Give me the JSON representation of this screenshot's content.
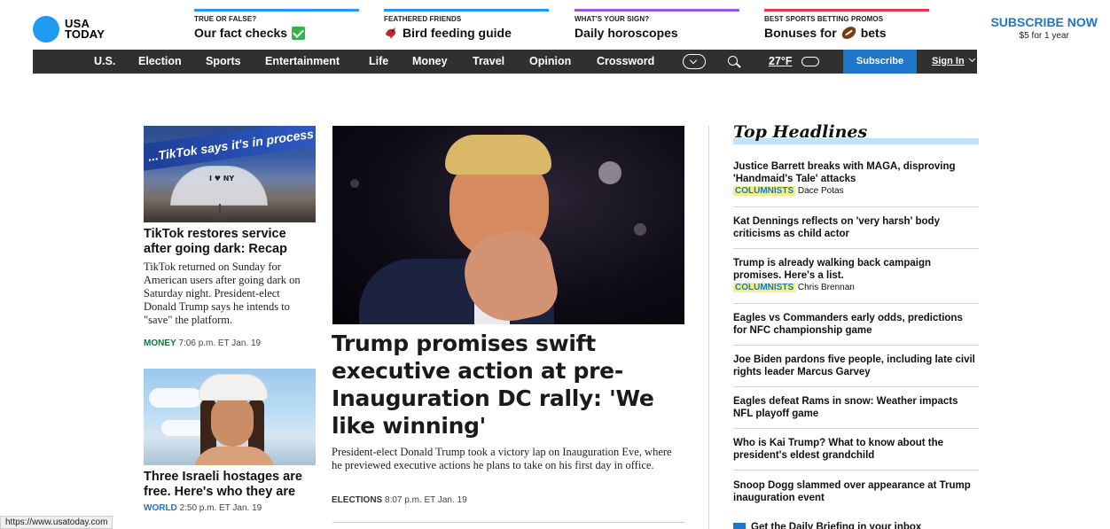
{
  "logo": {
    "line1": "USA",
    "line2": "TODAY"
  },
  "promos": [
    {
      "kicker": "TRUE OR FALSE?",
      "title": "Our fact checks",
      "icon": "check-icon",
      "color": "#1e9bf0"
    },
    {
      "kicker": "FEATHERED FRIENDS",
      "title": "Bird feeding guide",
      "icon": "bird-icon",
      "color": "#1e9bf0"
    },
    {
      "kicker": "WHAT'S YOUR SIGN?",
      "title": "Daily horoscopes",
      "icon": "",
      "color": "#9b57d6"
    },
    {
      "kicker": "BEST SPORTS BETTING PROMOS",
      "title_pre": "Bonuses for",
      "title_post": "bets",
      "icon": "football-icon",
      "color": "#e23a4a"
    }
  ],
  "subscribe_now": {
    "label": "SUBSCRIBE NOW",
    "offer": "$5 for 1 year"
  },
  "nav": {
    "items": [
      "U.S.",
      "Election",
      "Sports",
      "Entertainment",
      "Life",
      "Money",
      "Travel",
      "Opinion",
      "Crossword"
    ],
    "weather": "27°F",
    "subscribe": "Subscribe",
    "signin": "Sign In"
  },
  "left_stories": [
    {
      "headline": "TikTok restores service after going dark: Recap",
      "summary": "TikTok returned on Sunday for American users after going dark on Saturday night. President-elect Donald Trump says he intends to \"save\" the platform.",
      "tag": "MONEY",
      "time": "7:06 p.m. ET Jan. 19",
      "image_text": "...TikTok says it's in process of restoring service",
      "umbrella_text": "I ♥ NY"
    },
    {
      "headline": "Three Israeli hostages are free. Here's who they are",
      "tag": "WORLD",
      "time": "2:50 p.m. ET Jan. 19"
    }
  ],
  "main_story": {
    "headline": "Trump promises swift executive action at pre-Inauguration DC rally: 'We like winning'",
    "summary": "President-elect Donald Trump took a victory lap on Inauguration Eve, where he previewed executive actions he plans to take on his first day in office.",
    "tag": "ELECTIONS",
    "time": "8:07 p.m. ET Jan. 19"
  },
  "top_headlines": {
    "title": "Top Headlines",
    "items": [
      {
        "headline": "Justice Barrett breaks with MAGA, disproving 'Handmaid's Tale' attacks",
        "tag": "COLUMNISTS",
        "author": "Dace Potas"
      },
      {
        "headline": "Kat Dennings reflects on 'very harsh' body criticisms as child actor"
      },
      {
        "headline": "Trump is already walking back campaign promises. Here's a list.",
        "tag": "COLUMNISTS",
        "author": "Chris Brennan"
      },
      {
        "headline": "Eagles vs Commanders early odds, predictions for NFC championship game"
      },
      {
        "headline": "Joe Biden pardons five people, including late civil rights leader Marcus Garvey"
      },
      {
        "headline": "Eagles defeat Rams in snow: Weather impacts NFL playoff game"
      },
      {
        "headline": "Who is Kai Trump? What to know about the president's eldest grandchild"
      },
      {
        "headline": "Snoop Dogg slammed over appearance at Trump inauguration event"
      }
    ],
    "briefing": "Get the Daily Briefing in your inbox"
  },
  "status_url": "https://www.usatoday.com"
}
